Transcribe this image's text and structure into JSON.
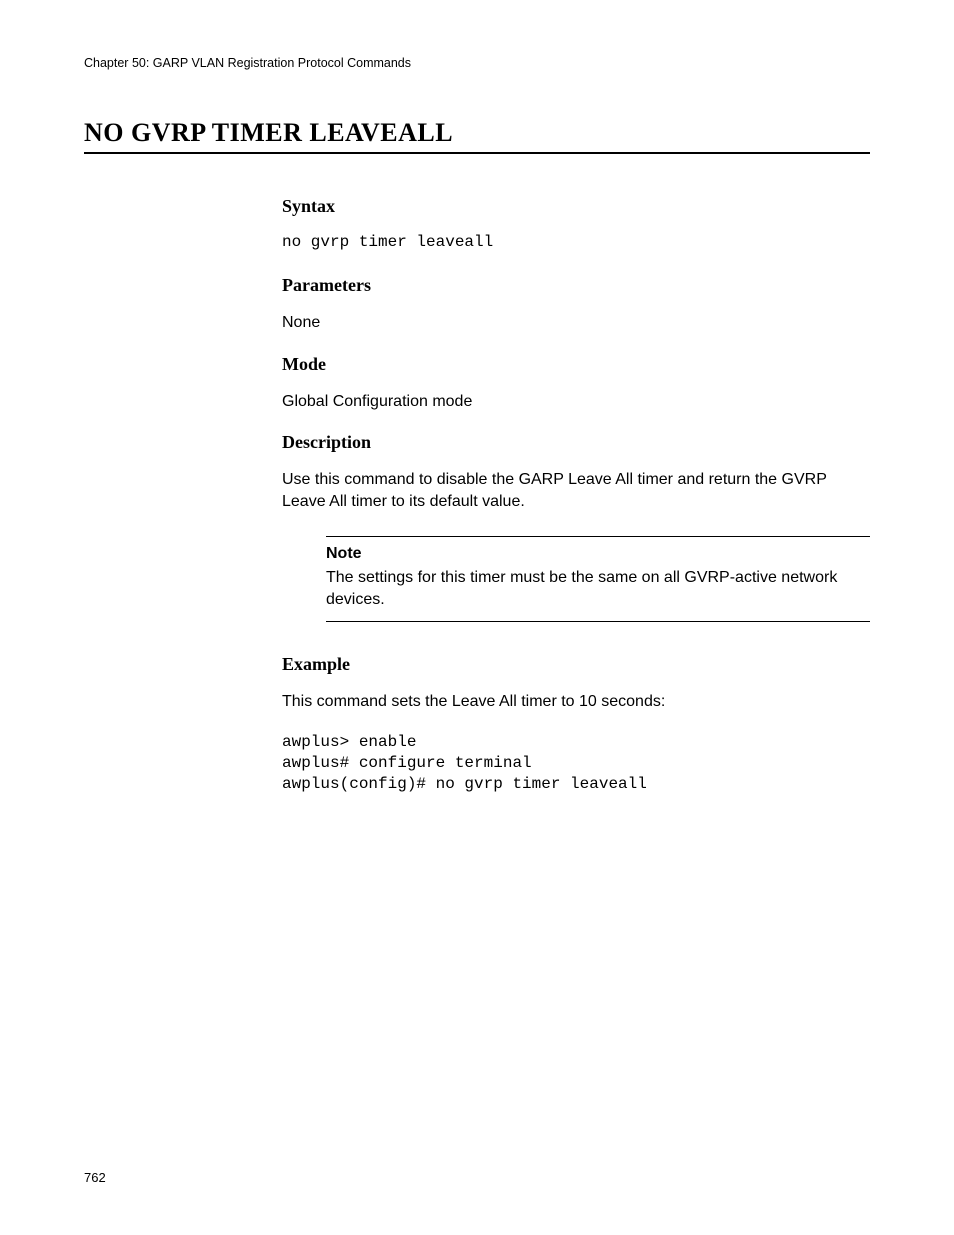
{
  "header": {
    "chapter": "Chapter 50: GARP VLAN Registration Protocol Commands"
  },
  "title": "NO GVRP TIMER LEAVEALL",
  "sections": {
    "syntax": {
      "heading": "Syntax",
      "code": "no gvrp timer leaveall"
    },
    "parameters": {
      "heading": "Parameters",
      "text": "None"
    },
    "mode": {
      "heading": "Mode",
      "text": "Global Configuration mode"
    },
    "description": {
      "heading": "Description",
      "text": "Use this command to disable the GARP Leave All timer and return the GVRP Leave All timer to its default value."
    },
    "note": {
      "label": "Note",
      "text": "The settings for this timer must be the same on all GVRP-active network devices."
    },
    "example": {
      "heading": "Example",
      "intro": "This command sets the Leave All timer to 10 seconds:",
      "code": "awplus> enable\nawplus# configure terminal\nawplus(config)# no gvrp timer leaveall"
    }
  },
  "pageNumber": "762"
}
